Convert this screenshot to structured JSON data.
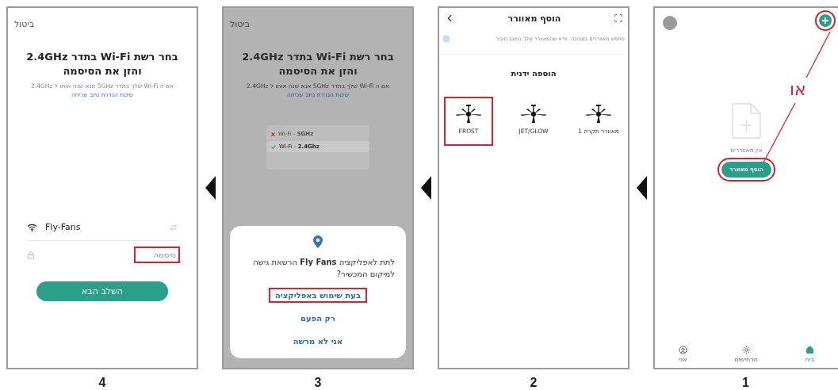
{
  "steps": [
    {
      "number": "1",
      "kind": "home",
      "plus_highlighted": true,
      "empty_text": "אין מאווררים",
      "add_button": {
        "label": "הוסף מאוורר",
        "highlighted": true
      },
      "annotation": "או",
      "tabs": [
        {
          "label": "בית",
          "selected": true
        },
        {
          "label": "תרחישים",
          "selected": false
        },
        {
          "label": "אני",
          "selected": false
        }
      ]
    },
    {
      "number": "2",
      "kind": "add_fan",
      "title": "הוסף מאוורר",
      "scan_text": "מחפש מאווררים בסביבה. וודא שהמאוורר שלך במצב חיבור",
      "section": "הוספה ידנית",
      "fans": [
        {
          "label": "מאוורר תקרה 1",
          "highlighted": false
        },
        {
          "label": "JET/GLOW",
          "highlighted": false
        },
        {
          "label": "FROST",
          "highlighted": true
        }
      ]
    },
    {
      "number": "3",
      "kind": "wifi",
      "dimmed": true,
      "cancel": "ביטול",
      "title": "בחר רשת Wi-Fi בתדר 2.4GHz והזן את הסיסמה",
      "subtitle": "אם ה Wi-Fi שלך בתדר 5GHz אנא שנה אותו ל 2.4GHz",
      "link": "שיטת הגדרת נתב שכיחה",
      "networks": [
        {
          "label": "Wi-Fi - **5GHz**",
          "selected": false
        },
        {
          "label": "Wi-Fi - **2.4Ghz**",
          "selected": true
        }
      ],
      "dialog": {
        "text": "לתת לאפליקציה **Fly Fans** הרשאת גישה למיקום המכשיר?",
        "options": [
          {
            "label": "בעת שימוש באפליקציה",
            "highlighted": true
          },
          {
            "label": "רק הפעם",
            "highlighted": false
          },
          {
            "label": "אני לא מרשה",
            "highlighted": false
          }
        ]
      }
    },
    {
      "number": "4",
      "kind": "wifi",
      "dimmed": false,
      "cancel": "ביטול",
      "title": "בחר רשת Wi-Fi בתדר 2.4GHz והזן את הסיסמה",
      "subtitle": "אם ה Wi-Fi שלך בתדר 5GHz אנא שנה אותו ל 2.4GHz",
      "link": "שיטת הגדרת נתב שכיחה",
      "network": "Fly-Fans",
      "password": {
        "placeholder": "סיסמה",
        "highlighted": true
      },
      "next_button": "השלב הבא"
    }
  ]
}
